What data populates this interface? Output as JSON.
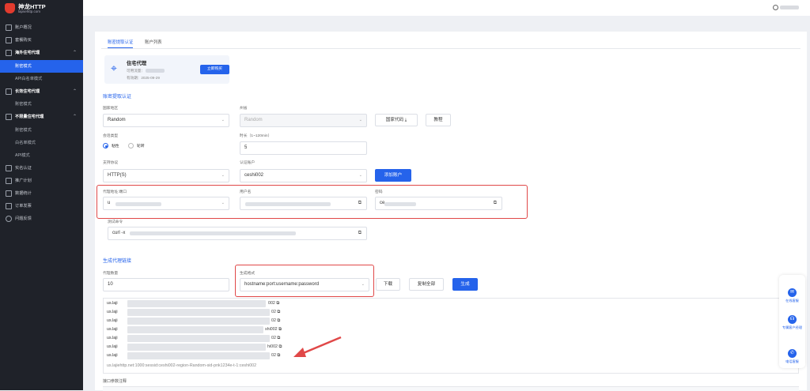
{
  "brand": {
    "title": "神龙HTTP",
    "subtitle": "lapsehttp.com"
  },
  "sidebar": {
    "items": [
      {
        "label": "账户概况",
        "icon": "dashboard-icon"
      },
      {
        "label": "套餐购买",
        "icon": "cart-icon"
      },
      {
        "label": "海外住宅代理",
        "icon": "globe-icon"
      },
      {
        "label": "账密模式"
      },
      {
        "label": "API白名单模式"
      },
      {
        "label": "长效住宅代理",
        "icon": "monitor-icon"
      },
      {
        "label": "账密模式"
      },
      {
        "label": "不限量住宅代理",
        "icon": "infinity-icon"
      },
      {
        "label": "账密模式"
      },
      {
        "label": "白名单模式"
      },
      {
        "label": "API模式"
      },
      {
        "label": "实名认证",
        "icon": "id-card-icon"
      },
      {
        "label": "推广计划",
        "icon": "gift-icon"
      },
      {
        "label": "数据统计",
        "icon": "chart-icon"
      },
      {
        "label": "订单发票",
        "icon": "receipt-icon"
      },
      {
        "label": "问题反馈",
        "icon": "feedback-icon"
      }
    ]
  },
  "tabs": [
    "账密提取认证",
    "账户列表"
  ],
  "card": {
    "title": "住宅代理",
    "available_label": "可用流量：",
    "expiry_label": "有效期：2025-09-29",
    "buy_label": "立即购买"
  },
  "section1": "账密提取认证",
  "form": {
    "country_label": "国家地区",
    "country_value": "Random",
    "state_label": "州省",
    "state_value": "Random",
    "country_code_btn": "国家代码 ⤓",
    "tutorial_btn": "教程",
    "session_label": "会话类型",
    "sticky": "粘性",
    "rotating": "轮转",
    "duration_label": "时长（1~120min）",
    "duration_value": "5",
    "protocol_label": "支持协议",
    "protocol_value": "HTTP(S)",
    "account_label": "认证账户",
    "account_value": "ceshi002",
    "add_account_btn": "添加账户",
    "addr_label": "代理地址:端口",
    "addr_value": "u",
    "user_label": "用户名",
    "pass_label": "密码",
    "pass_value": "ce",
    "test_label": "测试命令",
    "test_value": "curl -x"
  },
  "section2": "生成代理链接",
  "gen": {
    "qty_label": "代理数量",
    "qty_value": "10",
    "format_label": "生成格式",
    "format_value": "hostname:port:username:password",
    "download_btn": "下载",
    "copy_all_btn": "复制全部",
    "generate_btn": "生成"
  },
  "results": [
    {
      "prefix": "us.laji",
      "suffix": "002"
    },
    {
      "prefix": "us.laji",
      "suffix": "02"
    },
    {
      "prefix": "us.laji",
      "suffix": "02"
    },
    {
      "prefix": "us.laji",
      "suffix": "shi002"
    },
    {
      "prefix": "us.laji",
      "suffix": "02"
    },
    {
      "prefix": "us.laji",
      "suffix": "hi002"
    },
    {
      "prefix": "us.laji",
      "suffix": "02"
    },
    {
      "prefix": "us.lajiehttp.net:1000:sessid:ceshi002-region-Random-sid-pnk1234e-t-1:ceshi002",
      "suffix": ""
    }
  ],
  "footer": "接口参数注释",
  "float": {
    "service": "在线客服",
    "manager": "专属客户经理",
    "phone": "电话客服"
  },
  "colors": {
    "accent": "#2563eb",
    "sidebar": "#1f2229",
    "highlight": "#e04848"
  }
}
